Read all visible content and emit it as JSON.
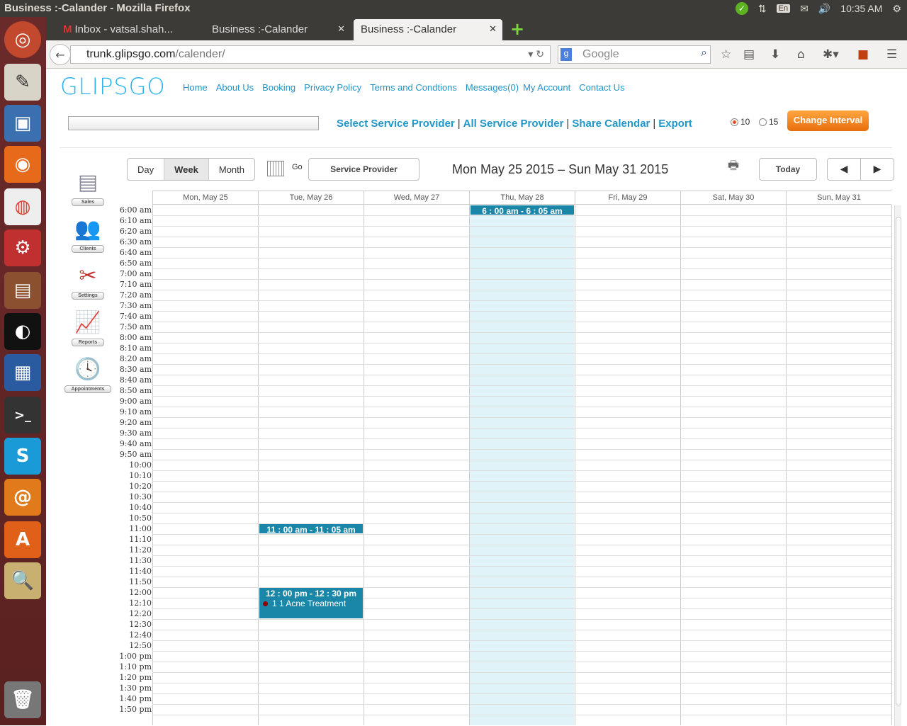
{
  "os": {
    "window_title": "Business :-Calander - Mozilla Firefox",
    "keyboard_layout": "En",
    "clock": "10:35 AM"
  },
  "browser": {
    "tabs": [
      {
        "label": "Inbox - vatsal.shah..."
      },
      {
        "label": "Business :-Calander"
      },
      {
        "label": "Business :-Calander"
      }
    ],
    "url_host": "trunk.glipsgo.com",
    "url_path": "/calender/",
    "search_placeholder": "Google"
  },
  "site": {
    "logo": "GLIPSGO",
    "menu": [
      "Home",
      "About Us",
      "Booking",
      "Privacy Policy",
      "Terms and Condtions",
      "Messages(0)",
      "My Account",
      "Contact Us"
    ],
    "action_links": [
      "Select Service Provider",
      "All Service Provider",
      "Share Calendar",
      "Export"
    ],
    "interval_options": [
      "10",
      "15"
    ],
    "interval_selected": "10",
    "change_interval_label": "Change Interval"
  },
  "sidebar": [
    {
      "label": "Sales",
      "icon": "sales-document-icon"
    },
    {
      "label": "Clients",
      "icon": "clients-people-icon"
    },
    {
      "label": "Settings",
      "icon": "settings-tools-icon"
    },
    {
      "label": "Reports",
      "icon": "reports-chart-icon"
    },
    {
      "label": "Appointments",
      "icon": "appointments-clock-icon"
    }
  ],
  "calendar": {
    "views": [
      "Day",
      "Week",
      "Month"
    ],
    "active_view": "Week",
    "go_label": "Go",
    "service_provider_label": "Service Provider",
    "date_range": "Mon May 25 2015 – Sun May 31 2015",
    "today_label": "Today",
    "prev_icon": "◀",
    "next_icon": "▶",
    "days": [
      "Mon, May 25",
      "Tue, May 26",
      "Wed, May 27",
      "Thu, May 28",
      "Fri, May 29",
      "Sat, May 30",
      "Sun, May 31"
    ],
    "highlighted_day": "Thu, May 28",
    "time_labels": [
      "6:00 am",
      "6:10 am",
      "6:20 am",
      "6:30 am",
      "6:40 am",
      "6:50 am",
      "7:00 am",
      "7:10 am",
      "7:20 am",
      "7:30 am",
      "7:40 am",
      "7:50 am",
      "8:00 am",
      "8:10 am",
      "8:20 am",
      "8:30 am",
      "8:40 am",
      "8:50 am",
      "9:00 am",
      "9:10 am",
      "9:20 am",
      "9:30 am",
      "9:40 am",
      "9:50 am",
      "10:00",
      "10:10",
      "10:20",
      "10:30",
      "10:40",
      "10:50",
      "11:00",
      "11:10",
      "11:20",
      "11:30",
      "11:40",
      "11:50",
      "12:00",
      "12:10",
      "12:20",
      "12:30",
      "12:40",
      "12:50",
      "1:00 pm",
      "1:10 pm",
      "1:20 pm",
      "1:30 pm",
      "1:40 pm",
      "1:50 pm"
    ],
    "events": [
      {
        "day": "Thu, May 28",
        "title": "6 : 00 am - 6 : 05 am",
        "detail": ""
      },
      {
        "day": "Tue, May 26",
        "title": "11 : 00 am - 11 : 05 am",
        "detail": ""
      },
      {
        "day": "Tue, May 26",
        "title": "12 : 00 pm - 12 : 30 pm",
        "detail": "1 1    Acne Treatment"
      }
    ]
  }
}
